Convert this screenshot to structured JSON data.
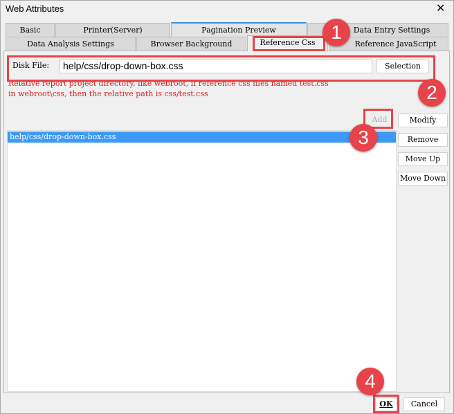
{
  "window": {
    "title": "Web Attributes",
    "close": "✕"
  },
  "tabs_row1": [
    "Basic",
    "Printer(Server)",
    "Pagination Preview",
    "Data Entry Settings"
  ],
  "tabs_row2": [
    "Data Analysis Settings",
    "Browser Background",
    "Reference Css",
    "Reference JavaScript"
  ],
  "form": {
    "disk_file_label": "Disk File:",
    "disk_file_value": "help/css/drop-down-box.css",
    "selection_label": "Selection",
    "hint_line1": "Relative report project directory, like webroot, if reference css files named test.css",
    "hint_line2": "in webroot\\css, then the relative path is css/test.css"
  },
  "buttons": {
    "add": "Add",
    "modify": "Modify",
    "remove": "Remove",
    "move_up": "Move Up",
    "move_down": "Move Down",
    "ok": "OK",
    "cancel": "Cancel"
  },
  "list": {
    "items": [
      "help/css/drop-down-box.css"
    ]
  },
  "annotations": [
    "1",
    "2",
    "3",
    "4"
  ]
}
